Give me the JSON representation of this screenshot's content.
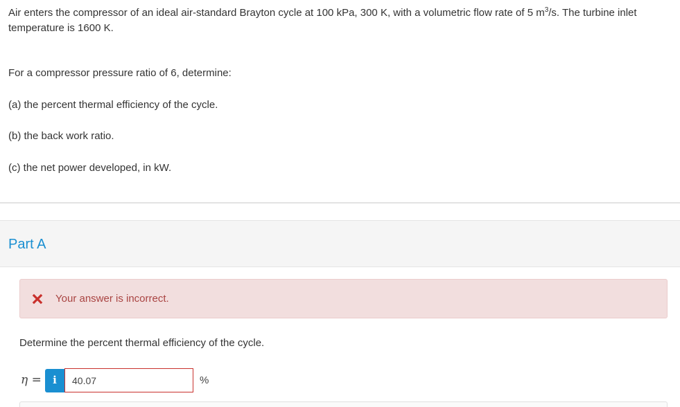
{
  "problem": {
    "intro_before_sup": "Air enters the compressor of an ideal air-standard Brayton cycle at 100 kPa, 300 K, with a volumetric flow rate of 5 m",
    "intro_sup": "3",
    "intro_after_sup": "/s. The turbine inlet temperature is 1600 K.",
    "lead": "For a compressor pressure ratio of 6, determine:",
    "items": [
      "(a) the percent thermal efficiency of the cycle.",
      "(b) the back work ratio.",
      "(c) the net power developed, in kW."
    ]
  },
  "part": {
    "title": "Part A"
  },
  "feedback": {
    "message": "Your answer is incorrect.",
    "icon": "x-mark-icon",
    "color": "#a94442"
  },
  "question": {
    "text": "Determine the percent thermal efficiency of the cycle.",
    "variable": "η =",
    "info_glyph": "i",
    "answer_value": "40.07",
    "unit": "%"
  },
  "colors": {
    "accent": "#1a8fd1",
    "error": "#c9302c",
    "error_bg": "#f2dede"
  }
}
